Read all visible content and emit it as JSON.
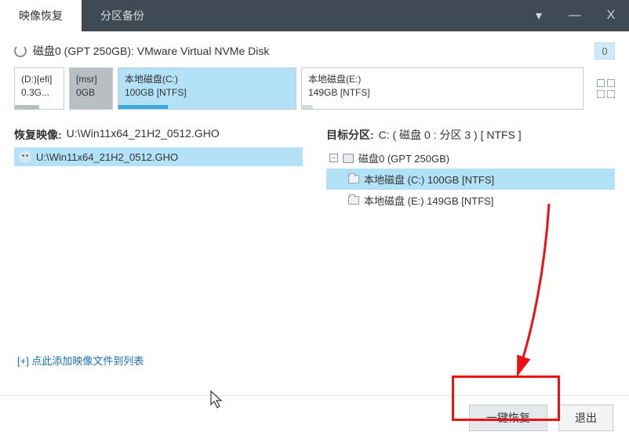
{
  "tabs": {
    "restore": "映像恢复",
    "backup": "分区备份"
  },
  "titlebar": {
    "dropdown": "▾",
    "minimize": "—",
    "close": "X"
  },
  "disk": {
    "label": "磁盘0 (GPT 250GB): VMware Virtual NVMe Disk",
    "index": "0"
  },
  "parts": {
    "efi": {
      "l1": "(D:)[efi]",
      "l2": "0.3G..."
    },
    "msr": {
      "l1": "[msr]",
      "l2": "0GB"
    },
    "c": {
      "l1": "本地磁盘(C:)",
      "l2": "100GB [NTFS]"
    },
    "e": {
      "l1": "本地磁盘(E:)",
      "l2": "149GB [NTFS]"
    }
  },
  "left": {
    "label": "恢复映像:",
    "value": "U:\\Win11x64_21H2_0512.GHO",
    "file": "U:\\Win11x64_21H2_0512.GHO",
    "addlink": "[+] 点此添加映像文件到列表"
  },
  "right": {
    "label": "目标分区:",
    "value": "C: ( 磁盘 0 : 分区 3 ) [ NTFS ]",
    "tree": {
      "disk": "磁盘0 (GPT 250GB)",
      "c": "本地磁盘 (C:) 100GB [NTFS]",
      "e": "本地磁盘 (E:) 149GB [NTFS]"
    }
  },
  "footer": {
    "restore": "一键恢复",
    "exit": "退出"
  }
}
